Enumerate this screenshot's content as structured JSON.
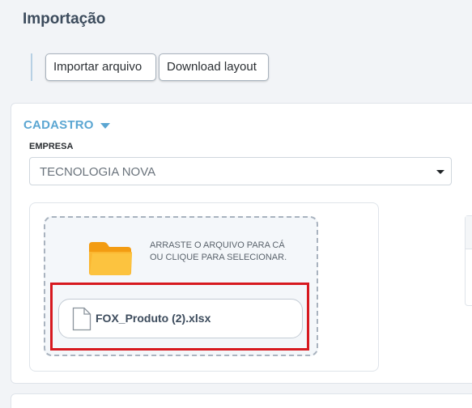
{
  "page": {
    "title": "Importação"
  },
  "toolbar": {
    "import_label": "Importar arquivo",
    "download_label": "Download layout"
  },
  "cadastro": {
    "section_label": "CADASTRO",
    "section_icon": "caret-down-icon",
    "empresa": {
      "label": "EMPRESA",
      "selected_value": "TECNOLOGIA NOVA"
    },
    "upload": {
      "folder_icon": "folder-icon",
      "instruction": "ARRASTE O ARQUIVO PARA CÁ OU CLIQUE PARA SELECIONAR.",
      "file": {
        "icon": "file-icon",
        "name": "FOX_Produto (2).xlsx"
      }
    }
  },
  "colors": {
    "accent": "#5ba6d2",
    "title": "#3c4b5c",
    "highlight": "#d7191f",
    "folder": "#f7a623"
  }
}
